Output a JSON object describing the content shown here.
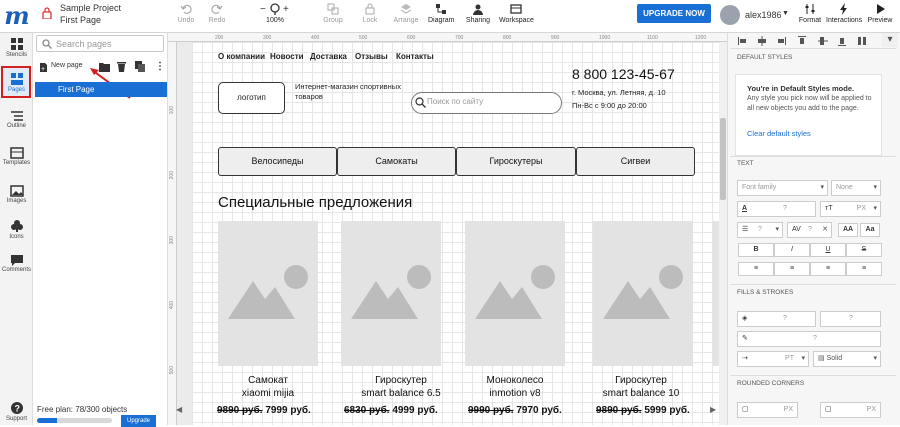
{
  "header": {
    "project_name": "Sample Project",
    "page_name": "First Page",
    "toolbar": [
      {
        "label": "Undo",
        "icon": "undo-icon"
      },
      {
        "label": "Redo",
        "icon": "redo-icon"
      },
      {
        "label": "100%",
        "icon": "zoom-icon"
      },
      {
        "label": "Group",
        "icon": "group-icon"
      },
      {
        "label": "Lock",
        "icon": "lock-icon"
      },
      {
        "label": "Arrange",
        "icon": "arrange-icon"
      },
      {
        "label": "Diagram",
        "icon": "diagram-icon"
      },
      {
        "label": "Sharing",
        "icon": "sharing-icon"
      },
      {
        "label": "Workspace",
        "icon": "workspace-icon"
      }
    ],
    "upgrade_label": "UPGRADE NOW",
    "username": "alex1986",
    "right_tools": [
      {
        "label": "Format",
        "icon": "format-icon"
      },
      {
        "label": "Interactions",
        "icon": "lightning-icon"
      },
      {
        "label": "Preview",
        "icon": "preview-icon"
      }
    ]
  },
  "rail": [
    {
      "label": "Stencils",
      "icon": "stencils-icon"
    },
    {
      "label": "Pages",
      "icon": "pages-icon"
    },
    {
      "label": "Outline",
      "icon": "outline-icon"
    },
    {
      "label": "Templates",
      "icon": "templates-icon"
    },
    {
      "label": "Images",
      "icon": "images-icon"
    },
    {
      "label": "Icons",
      "icon": "icons-icon"
    },
    {
      "label": "Comments",
      "icon": "comments-icon"
    },
    {
      "label": "Support",
      "icon": "support-icon"
    }
  ],
  "pages_panel": {
    "search_placeholder": "Search pages",
    "new_page_label": "New page",
    "pages": [
      "First Page"
    ],
    "plan_text": "Free plan: 78/300 objects",
    "plan_used": 78,
    "plan_limit": 300,
    "upgrade_label": "Upgrade"
  },
  "rulers": {
    "top": [
      "200",
      "300",
      "400",
      "500",
      "600",
      "700",
      "800",
      "900",
      "1000",
      "1100",
      "1200"
    ],
    "left": [
      "100",
      "200",
      "300",
      "400",
      "500"
    ]
  },
  "mockup": {
    "nav": [
      "О компании",
      "Новости",
      "Доставка",
      "Отзывы",
      "Контакты"
    ],
    "logo_label": "логотип",
    "tagline": "Интернет-магазин спортивных товаров",
    "search_placeholder": "Поиск по сайту",
    "phone": "8 800 123-45-67",
    "address": "г. Москва, ул. Летняя, д. 10",
    "hours": "Пн-Вс с 9:00 до 20:00",
    "categories": [
      "Велосипеды",
      "Самокаты",
      "Гироскутеры",
      "Сигвеи"
    ],
    "offers_title": "Специальные предложения",
    "products": [
      {
        "line1": "Самокат",
        "line2": "xiaomi mijia",
        "old_price": "9890 руб.",
        "price": "7999 руб."
      },
      {
        "line1": "Гироскутер",
        "line2": "smart balance 6.5",
        "old_price": "6830 руб.",
        "price": "4999 руб."
      },
      {
        "line1": "Моноколесо",
        "line2": "inmotion v8",
        "old_price": "9990 руб.",
        "price": "7970 руб."
      },
      {
        "line1": "Гироскутер",
        "line2": "smart balance 10",
        "old_price": "9890 руб.",
        "price": "5999 руб."
      }
    ]
  },
  "format_panel": {
    "default_styles_title": "DEFAULT STYLES",
    "default_bold": "You're in Default Styles mode.",
    "default_desc": "Any style you pick now will be applied to all new objects you add to the page.",
    "clear_link": "Clear default styles",
    "text_title": "TEXT",
    "font_family_placeholder": "Font family",
    "font_weight": "None",
    "q1": "?",
    "px1": "PX",
    "q2": "?",
    "q3": "?",
    "btn_aa1": "AA",
    "btn_aa2": "Aa",
    "btn_b": "B",
    "btn_i": "I",
    "btn_u": "U",
    "btn_s": "S",
    "fills_title": "FILLS & STROKES",
    "fill_q1": "?",
    "fill_q2": "?",
    "fill_q3": "?",
    "pt_label": "PT",
    "stroke_q": "?",
    "stroke_style": "Solid",
    "rounded_title": "ROUNDED CORNERS",
    "rc_px1": "PX",
    "rc_px2": "PX"
  },
  "colors": {
    "accent": "#1a6fd4",
    "highlight": "#d21f1f"
  }
}
